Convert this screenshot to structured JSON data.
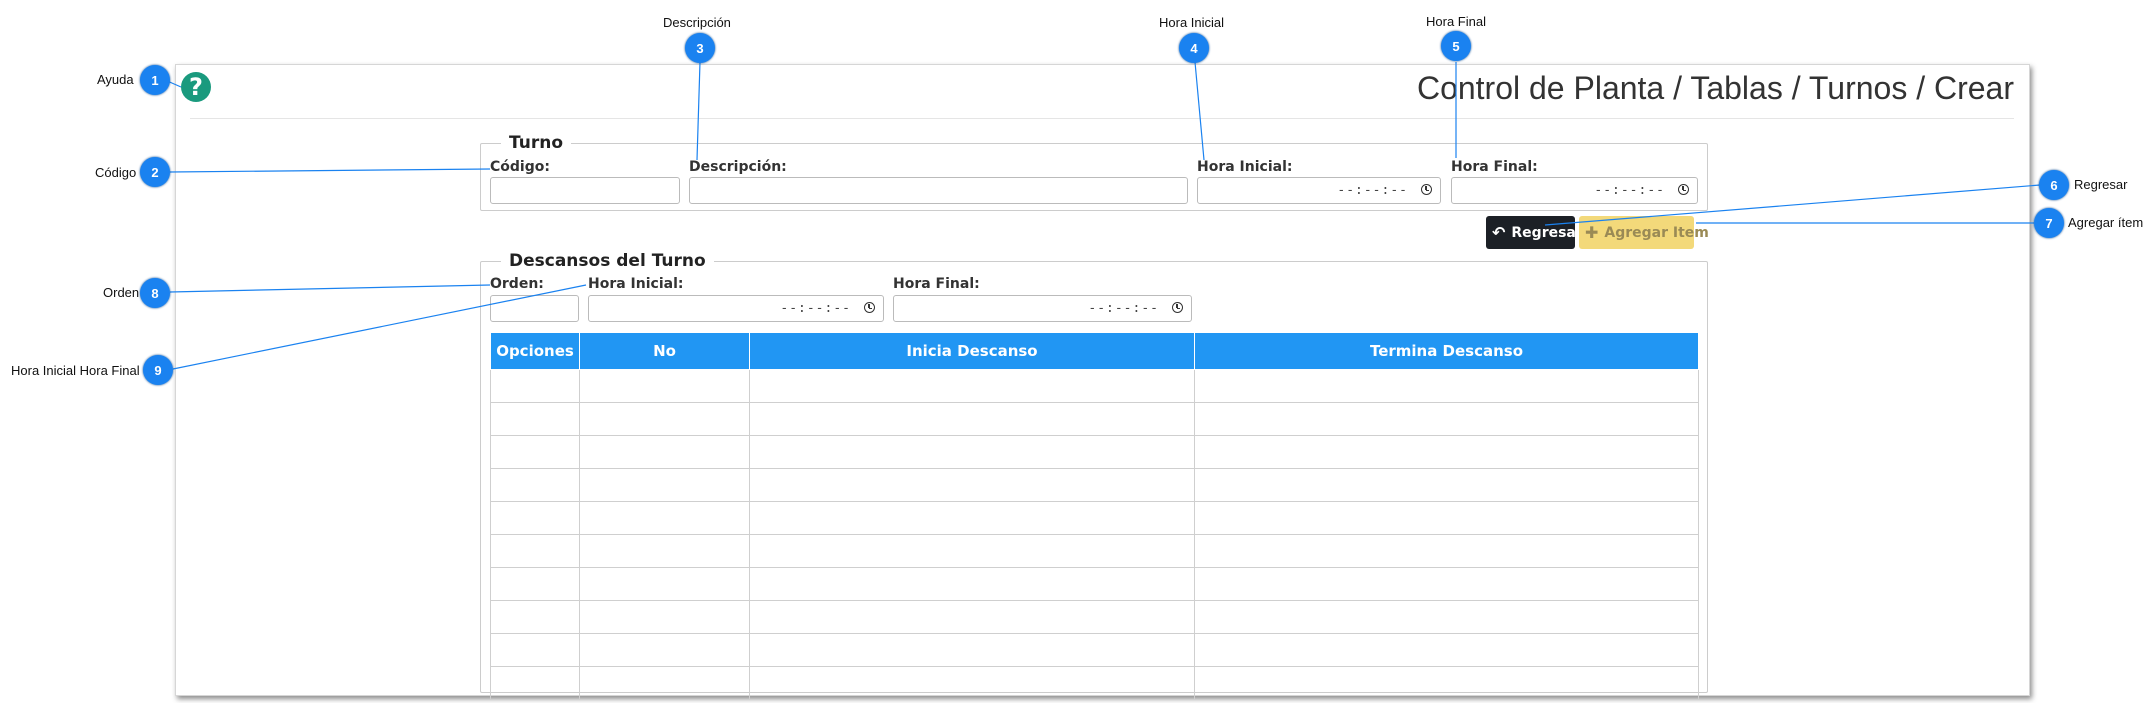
{
  "app": {
    "title": "Control de Planta / Tablas / Turnos / Crear",
    "help_icon": "question-circle-icon"
  },
  "turno": {
    "legend": "Turno",
    "codigo_label": "Código:",
    "codigo_value": "",
    "descripcion_label": "Descripción:",
    "descripcion_value": "",
    "hora_inicial_label": "Hora Inicial:",
    "hora_inicial_value": "--:--:--",
    "hora_final_label": "Hora Final:",
    "hora_final_value": "--:--:--"
  },
  "actions": {
    "regresar_label": "Regresar",
    "regresar_icon": "undo-arrow-icon",
    "agregar_label": "Agregar Item",
    "agregar_icon": "plus-icon"
  },
  "descansos": {
    "legend": "Descansos del Turno",
    "orden_label": "Orden:",
    "orden_value": "",
    "hora_inicial_label": "Hora Inicial:",
    "hora_inicial_value": "--:--:--",
    "hora_final_label": "Hora Final:",
    "hora_final_value": "--:--:--",
    "table": {
      "columns": [
        "Opciones",
        "No",
        "Inicia Descanso",
        "Termina Descanso"
      ],
      "empty_rows": 10
    }
  },
  "annotations": [
    {
      "num": "1",
      "label": "Ayuda"
    },
    {
      "num": "2",
      "label": "Código"
    },
    {
      "num": "3",
      "label": "Descripción"
    },
    {
      "num": "4",
      "label": "Hora Inicial"
    },
    {
      "num": "5",
      "label": "Hora Final"
    },
    {
      "num": "6",
      "label": "Regresar"
    },
    {
      "num": "7",
      "label": "Agregar ítem"
    },
    {
      "num": "8",
      "label": "Orden"
    },
    {
      "num": "9",
      "label": "Hora Inicial Hora Final"
    }
  ],
  "colors": {
    "badge": "#1a82f0",
    "table_header": "#2196f3",
    "help_icon": "#1a9a7e",
    "regresar_bg": "#1c2026",
    "agregar_bg": "#f3d97a"
  }
}
